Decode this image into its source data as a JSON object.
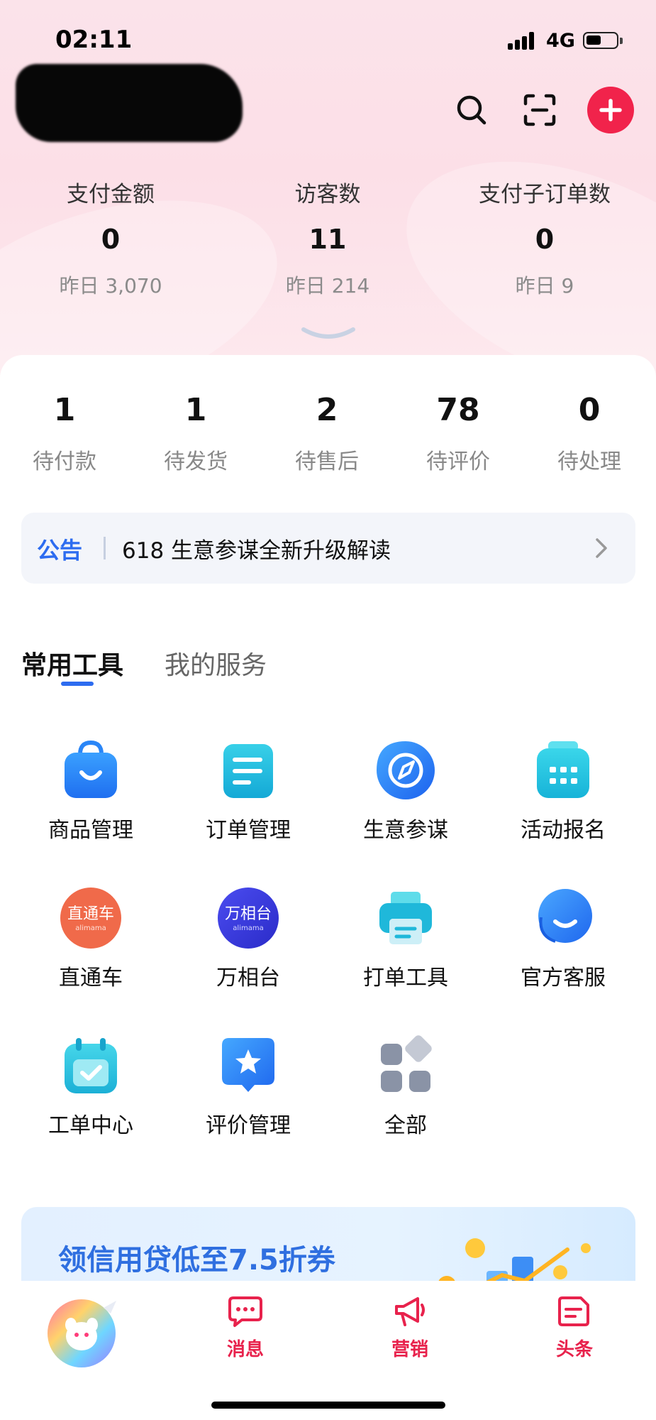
{
  "status_bar": {
    "time": "02:11",
    "network": "4G"
  },
  "header": {
    "search_icon": "search-icon",
    "scan_icon": "scan-icon",
    "add_icon": "plus-icon",
    "accent": "#f1234b"
  },
  "stats": [
    {
      "label": "支付金额",
      "value": "0",
      "yesterday": "昨日 3,070"
    },
    {
      "label": "访客数",
      "value": "11",
      "yesterday": "昨日 214"
    },
    {
      "label": "支付子订单数",
      "value": "0",
      "yesterday": "昨日 9"
    }
  ],
  "orders": [
    {
      "count": "1",
      "label": "待付款"
    },
    {
      "count": "1",
      "label": "待发货"
    },
    {
      "count": "2",
      "label": "待售后"
    },
    {
      "count": "78",
      "label": "待评价"
    },
    {
      "count": "0",
      "label": "待处理"
    }
  ],
  "notice": {
    "tag": "公告",
    "text": "618 生意参谋全新升级解读"
  },
  "tabs": {
    "active": "常用工具",
    "inactive": "我的服务"
  },
  "tools": [
    {
      "label": "商品管理",
      "icon": "shopping-bag-icon"
    },
    {
      "label": "订单管理",
      "icon": "order-list-icon"
    },
    {
      "label": "生意参谋",
      "icon": "compass-icon"
    },
    {
      "label": "活动报名",
      "icon": "calendar-grid-icon"
    },
    {
      "label": "直通车",
      "icon": "zhitongche-logo",
      "logo_text": "直通车",
      "logo_sub": "alimama"
    },
    {
      "label": "万相台",
      "icon": "wanxiangtai-logo",
      "logo_text": "万相台",
      "logo_sub": "alimama"
    },
    {
      "label": "打单工具",
      "icon": "printer-icon"
    },
    {
      "label": "官方客服",
      "icon": "customer-service-icon"
    },
    {
      "label": "工单中心",
      "icon": "calendar-check-icon"
    },
    {
      "label": "评价管理",
      "icon": "star-badge-icon"
    },
    {
      "label": "全部",
      "icon": "all-apps-icon"
    }
  ],
  "banner": {
    "text": "领信用贷低至7.5折券"
  },
  "tabbar": [
    {
      "label": "消息",
      "icon": "message-icon"
    },
    {
      "label": "营销",
      "icon": "megaphone-icon"
    },
    {
      "label": "头条",
      "icon": "headline-icon"
    }
  ],
  "colors": {
    "brand_red": "#e8224c",
    "link_blue": "#2d6cf0",
    "banner_blue": "#2f6fe0"
  }
}
